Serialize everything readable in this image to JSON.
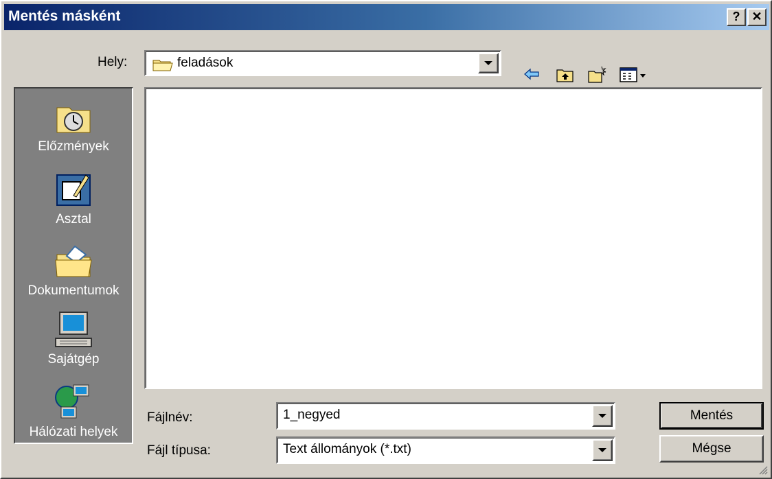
{
  "window": {
    "title": "Mentés másként",
    "help_btn": "?",
    "close_btn": "✕"
  },
  "location": {
    "label": "Hely:",
    "value": "feladások"
  },
  "toolbar": {
    "icons": [
      "back-arrow-icon",
      "up-folder-icon",
      "new-folder-icon",
      "view-menu-icon"
    ]
  },
  "places": [
    {
      "label": "Előzmények",
      "icon": "history-icon"
    },
    {
      "label": "Asztal",
      "icon": "desktop-icon"
    },
    {
      "label": "Dokumentumok",
      "icon": "documents-icon"
    },
    {
      "label": "Sajátgép",
      "icon": "computer-icon"
    },
    {
      "label": "Hálózati helyek",
      "icon": "network-icon"
    }
  ],
  "filename": {
    "label": "Fájlnév:",
    "value": "1_negyed"
  },
  "filetype": {
    "label": "Fájl típusa:",
    "value": "Text állományok (*.txt)"
  },
  "buttons": {
    "save": "Mentés",
    "cancel": "Mégse"
  }
}
